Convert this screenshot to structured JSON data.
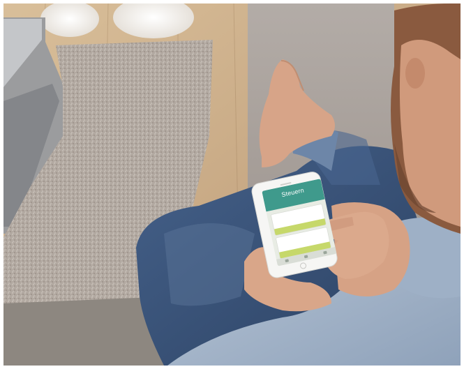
{
  "scene": {
    "description_free": true,
    "colors": {
      "floor": "#c8a77c",
      "rug": "#b3aaa2",
      "sofa": "#aaa29c",
      "jeans": "#3a5477",
      "shirt": "#a8b8cc",
      "skin": "#d9a487",
      "phone_screen_accent": "#3f9a8c",
      "phone_button_accent": "#c6d86a"
    }
  },
  "phone_screen": {
    "title": "Steuern",
    "subtitle": "",
    "card_1_label": "",
    "card_2_label": ""
  }
}
